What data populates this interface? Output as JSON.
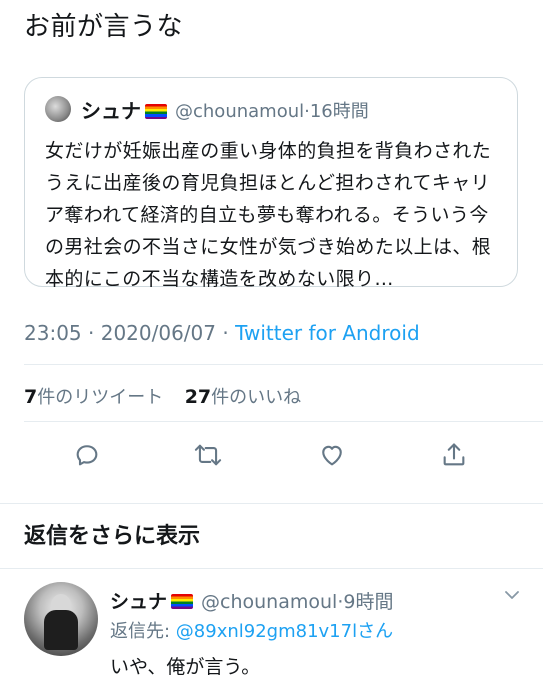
{
  "tweet": {
    "text": "お前が言うな",
    "meta": {
      "time": "23:05",
      "date": "2020/06/07",
      "client": "Twitter for Android",
      "separator": " · "
    },
    "stats": {
      "retweets_count": "7",
      "retweets_label": "件のリツイート",
      "likes_count": "27",
      "likes_label": "件のいいね"
    }
  },
  "quoted_tweet": {
    "name": "シュナ",
    "handle": "@chounamoul",
    "separator": "·",
    "age": "16時間",
    "body": "女だけが妊娠出産の重い身体的負担を背負わされたうえに出産後の育児負担ほとんど担わされてキャリア奪われて経済的自立も夢も奪われる。そういう今の男社会の不当さに女性が気づき始めた以上は、根本的にこの不当な構造を改めない限り…"
  },
  "actions": {
    "icons": [
      "reply-icon",
      "retweet-icon",
      "like-icon",
      "share-icon"
    ]
  },
  "more_replies": {
    "label": "返信をさらに表示"
  },
  "reply": {
    "name": "シュナ",
    "handle": "@chounamoul",
    "separator": "·",
    "age": "9時間",
    "reply_to_label": "返信先: ",
    "reply_to_handle": "@89xnl92gm81v17lさん",
    "text": "いや、俺が言う。"
  },
  "colors": {
    "accent": "#1da1f2",
    "secondary_text": "#657786",
    "primary_text": "#14171a",
    "border": "#cfd9de"
  }
}
